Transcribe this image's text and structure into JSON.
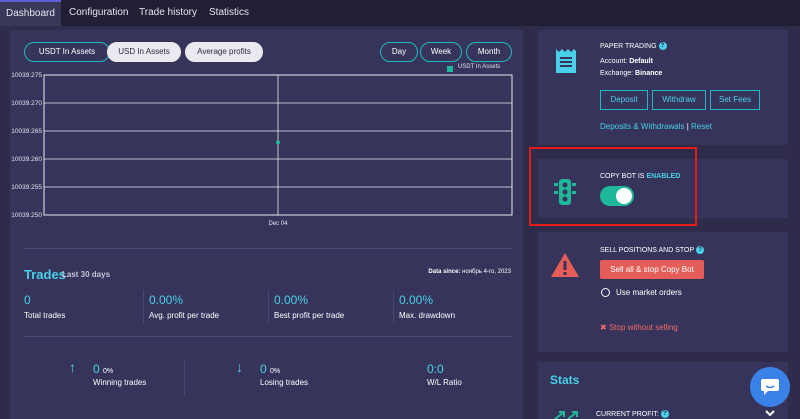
{
  "tabs": [
    {
      "label": "Dashboard",
      "active": true
    },
    {
      "label": "Configuration"
    },
    {
      "label": "Trade history"
    },
    {
      "label": "Statistics"
    }
  ],
  "chart_controls": {
    "asset_buttons": [
      "USDT In Assets",
      "USD In Assets",
      "Average profits"
    ],
    "selected_asset": "USD In Assets",
    "range_buttons": [
      "Day",
      "Week",
      "Month"
    ],
    "selected_range": "Day"
  },
  "chart_data": {
    "type": "scatter",
    "series": [
      {
        "name": "USDT In Assets",
        "color": "#1fb89a",
        "points": [
          {
            "x": "Dec 04",
            "y": 10039.263
          }
        ]
      }
    ],
    "x_ticks": [
      "Dec 04"
    ],
    "y_ticks": [
      "10039.275",
      "10039.270",
      "10039.265",
      "10039.260",
      "10039.255",
      "10039.250"
    ],
    "ylim": [
      10039.25,
      10039.275
    ],
    "grid": true,
    "legend": "top-right"
  },
  "trades": {
    "title": "Trades",
    "subtitle": "Last 30 days",
    "data_since_label": "Data since:",
    "data_since_value": "ноябрь 4-го, 2023",
    "stats": [
      {
        "value": "0",
        "label": "Total trades"
      },
      {
        "value": "0.00%",
        "label": "Avg. profit per trade"
      },
      {
        "value": "0.00%",
        "label": "Best profit per trade"
      },
      {
        "value": "0.00%",
        "label": "Max. drawdown"
      }
    ],
    "winning": {
      "arrow": "↑",
      "count": "0",
      "pct": "0%",
      "label": "Winning trades"
    },
    "losing": {
      "arrow": "↓",
      "count": "0",
      "pct": "0%",
      "label": "Losing trades"
    },
    "wl": {
      "value": "0:0",
      "label": "W/L Ratio"
    }
  },
  "paper_card": {
    "title": "PAPER TRADING",
    "account_label": "Account:",
    "account_value": "Default",
    "exchange_label": "Exchange:",
    "exchange_value": "Binance",
    "buttons": [
      "Deposit",
      "Withdraw",
      "Set Fees"
    ],
    "link_deposits": "Deposits & Withdrawals",
    "link_sep": "|",
    "link_reset": "Reset",
    "icon": "receipt-icon"
  },
  "copybot_card": {
    "label_prefix": "COPY BOT IS",
    "label_state": "ENABLED",
    "enabled": true,
    "icon": "traffic-light-icon"
  },
  "sell_card": {
    "title": "SELL POSITIONS AND STOP",
    "button": "Sell all & stop Copy Bot",
    "radio_label": "Use market orders",
    "stop_link": "Stop without selling",
    "icon": "warning-icon"
  },
  "stats_card": {
    "title": "Stats",
    "current_profit_label": "CURRENT PROFIT:"
  },
  "colors": {
    "accent": "#4ad0e8",
    "green": "#1fb89a",
    "danger": "#e55d58",
    "panel": "#36345a",
    "background": "#2e2c4a",
    "chat": "#3b82e8"
  }
}
